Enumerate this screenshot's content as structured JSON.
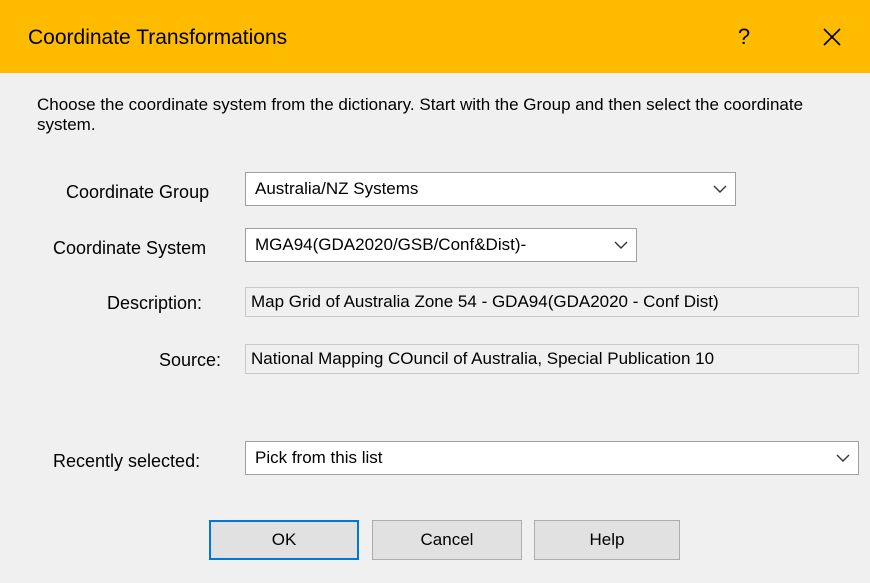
{
  "window": {
    "title": "Coordinate Transformations",
    "help_glyph": "?",
    "close_icon": "close-icon"
  },
  "instructions": "Choose the coordinate system from the dictionary.  Start with the Group and then select the coordinate system.",
  "coordinate_group": {
    "label": "Coordinate Group",
    "value": "Australia/NZ Systems"
  },
  "coordinate_system": {
    "label": "Coordinate System",
    "value": "MGA94(GDA2020/GSB/Conf&Dist)-"
  },
  "description": {
    "label": "Description:",
    "value": "Map Grid of Australia Zone 54 - GDA94(GDA2020 - Conf  Dist)"
  },
  "source": {
    "label": "Source:",
    "value": "National Mapping COuncil of Australia, Special Publication 10"
  },
  "recently_selected": {
    "label": "Recently selected:",
    "value": "Pick from this list"
  },
  "buttons": {
    "ok": "OK",
    "cancel": "Cancel",
    "help": "Help"
  },
  "colors": {
    "titlebar": "#ffbb00",
    "dialog_bg": "#f0f0f0",
    "focus_border": "#0078d7"
  }
}
